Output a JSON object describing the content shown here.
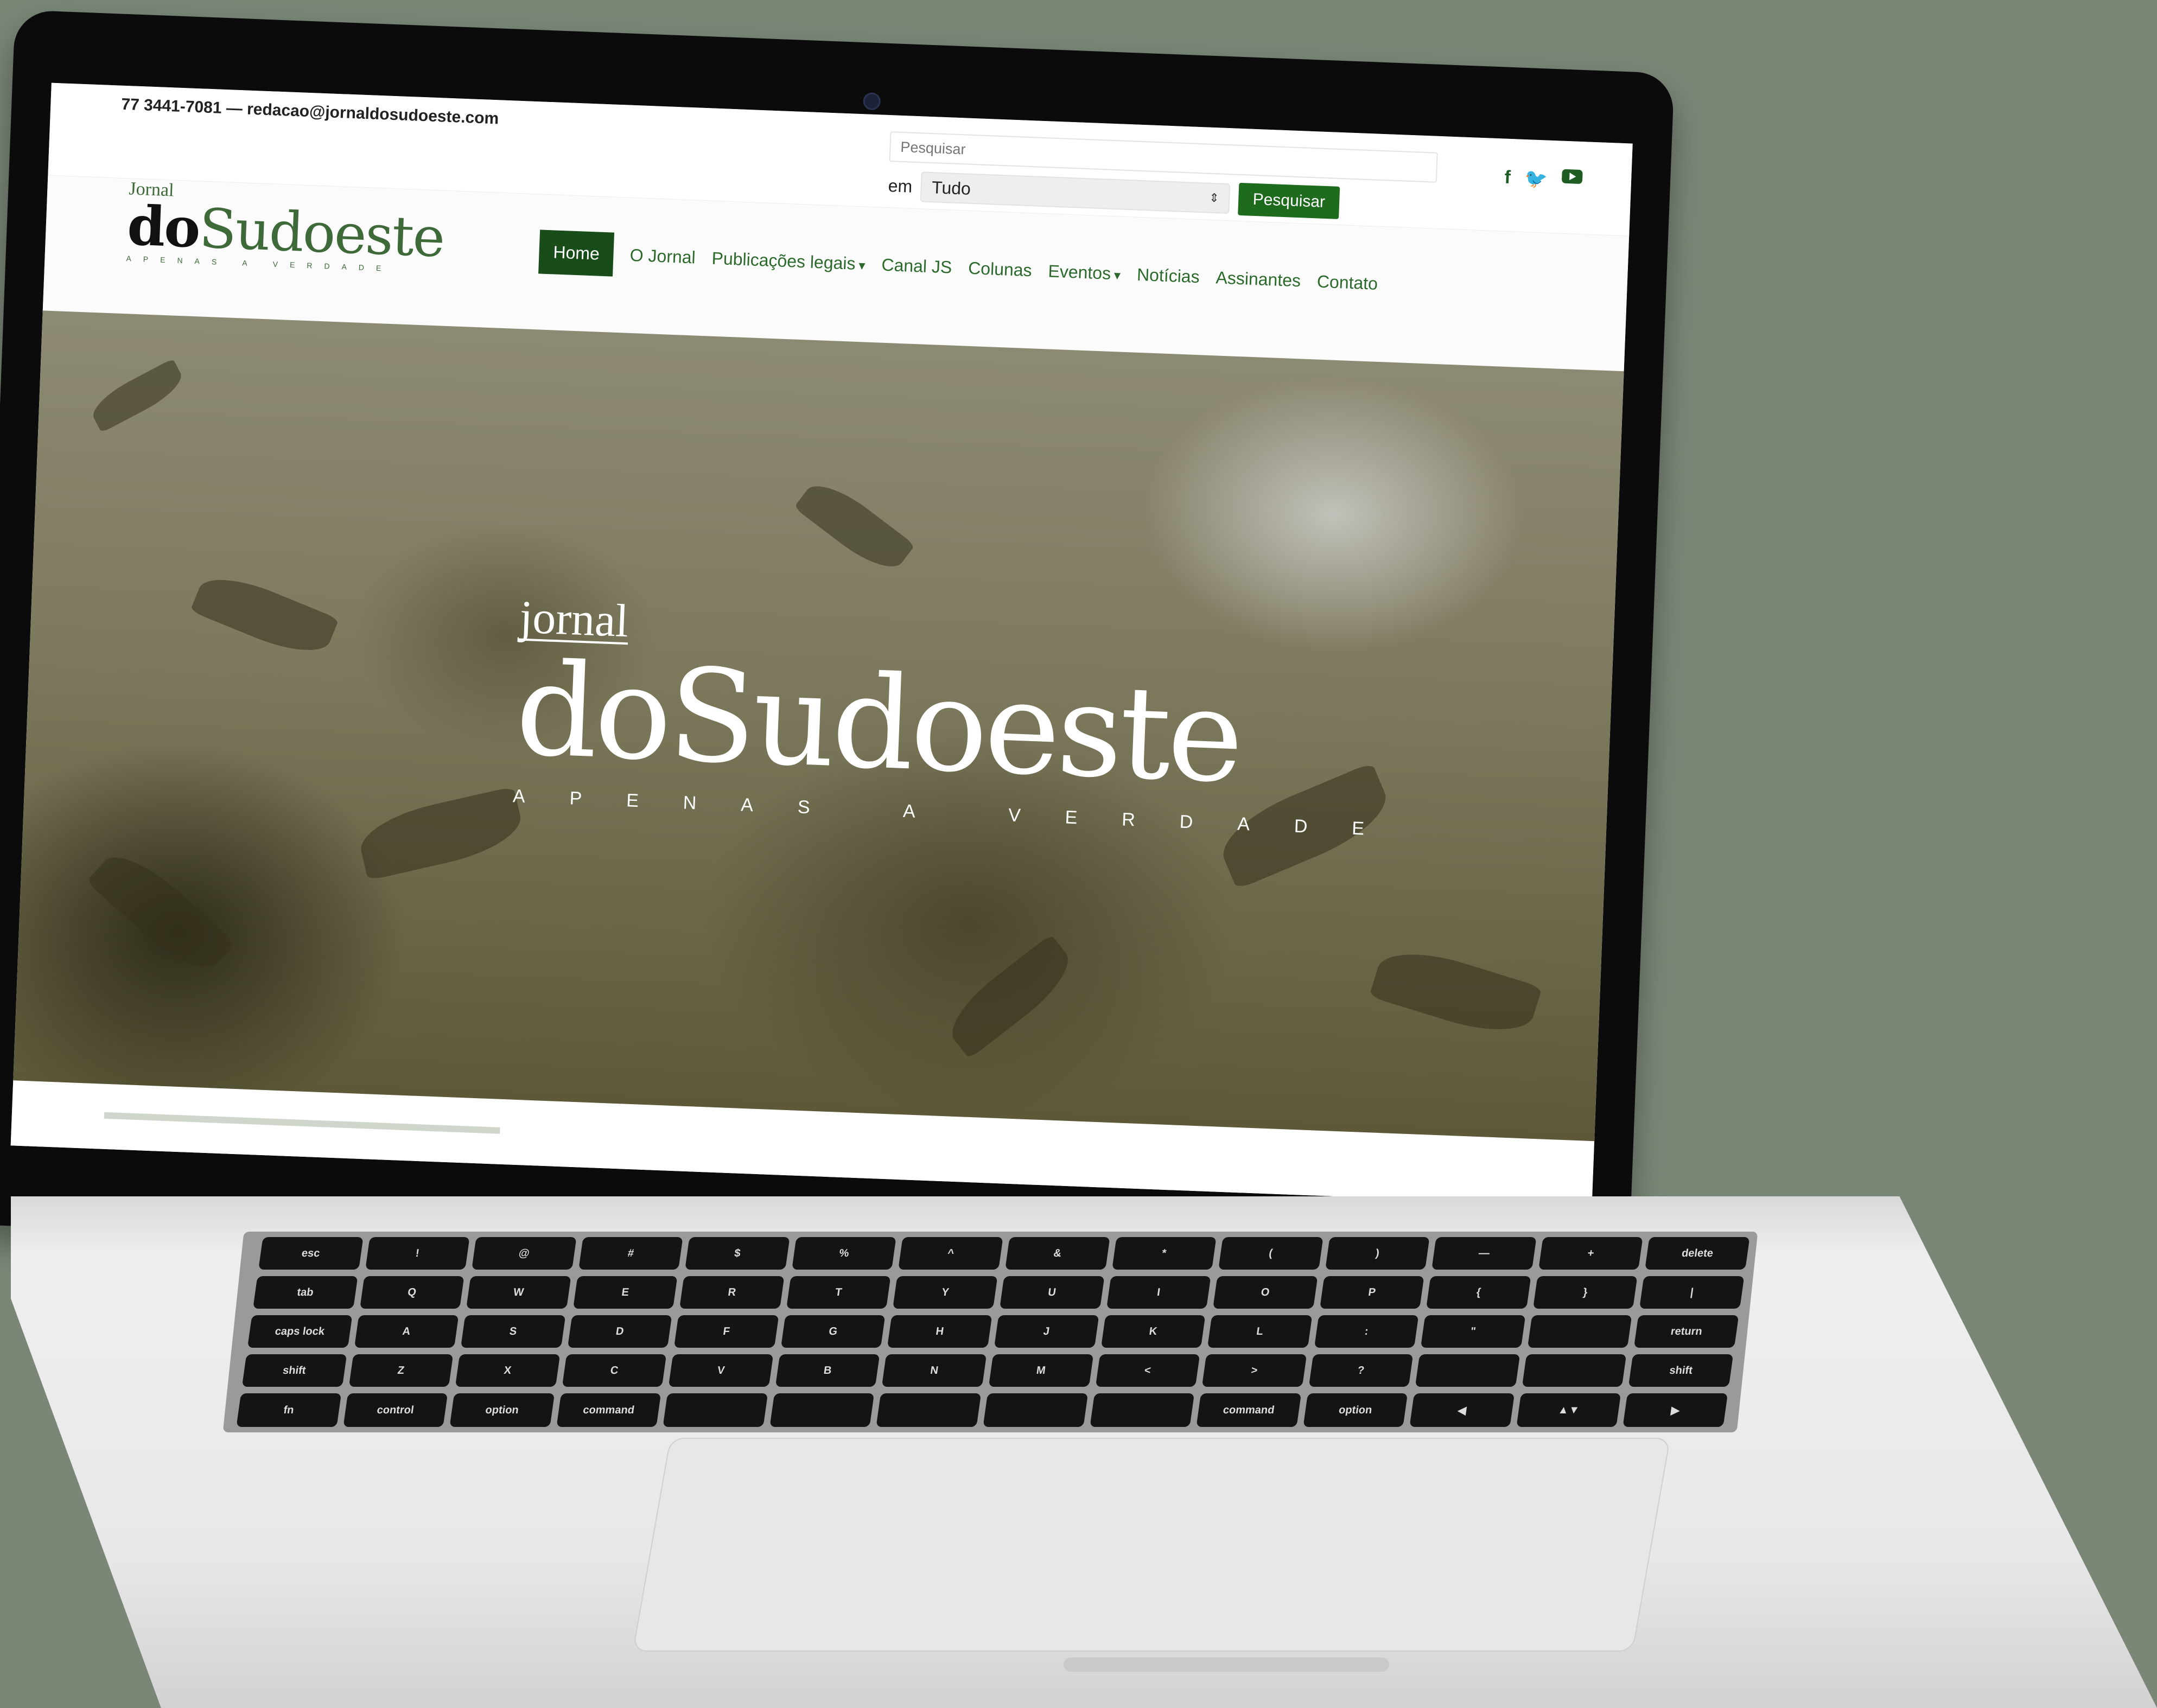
{
  "contact": {
    "text": "77 3441-7081 — redacao@jornaldosudoeste.com"
  },
  "search": {
    "placeholder": "Pesquisar",
    "scope_label": "em",
    "scope_value": "Tudo",
    "button_label": "Pesquisar"
  },
  "social": {
    "facebook": "f",
    "twitter": "t",
    "youtube": "youtube"
  },
  "logo": {
    "jornal": "Jornal",
    "do": "do",
    "sudoeste": "Sudoeste",
    "tagline": "APENAS A VERDADE"
  },
  "nav": {
    "items": [
      {
        "label": "Home"
      },
      {
        "label": "O Jornal"
      },
      {
        "label": "Publicações legais"
      },
      {
        "label": "Canal JS"
      },
      {
        "label": "Colunas"
      },
      {
        "label": "Eventos"
      },
      {
        "label": "Notícias"
      },
      {
        "label": "Assinantes"
      },
      {
        "label": "Contato"
      }
    ]
  },
  "hero": {
    "jornal": "jornal",
    "do": "do",
    "sudoeste": "Sudoeste",
    "tagline": "APENAS A VERDADE"
  },
  "colors": {
    "brand_green": "#1e6b1e",
    "nav_active": "#184c18",
    "background": "#7a8777"
  },
  "keyboard": {
    "row1": [
      "esc",
      "!",
      "@",
      "#",
      "$",
      "%",
      "^",
      "&",
      "*",
      "(",
      ")",
      "—",
      "+",
      "delete"
    ],
    "row2": [
      "tab",
      "Q",
      "W",
      "E",
      "R",
      "T",
      "Y",
      "U",
      "I",
      "O",
      "P",
      "{",
      "}",
      "|"
    ],
    "row3": [
      "caps lock",
      "A",
      "S",
      "D",
      "F",
      "G",
      "H",
      "J",
      "K",
      "L",
      ":",
      "\"",
      "",
      "return"
    ],
    "row4": [
      "shift",
      "Z",
      "X",
      "C",
      "V",
      "B",
      "N",
      "M",
      "<",
      ">",
      "?",
      "",
      "",
      "shift"
    ],
    "row5": [
      "fn",
      "control",
      "option",
      "command",
      "",
      "",
      "",
      "",
      "",
      "command",
      "option",
      "◀",
      "▲▼",
      "▶"
    ]
  }
}
